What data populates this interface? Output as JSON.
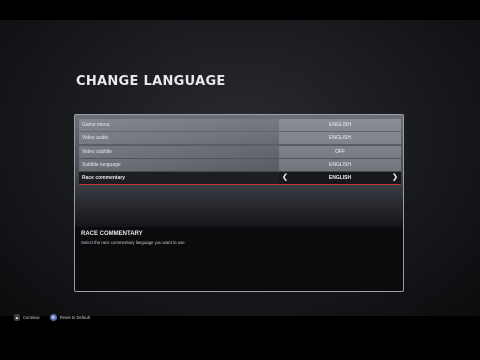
{
  "page": {
    "title": "CHANGE LANGUAGE"
  },
  "settings": [
    {
      "label": "Game menu",
      "value": "ENGLISH"
    },
    {
      "label": "Video audio",
      "value": "ENGLISH"
    },
    {
      "label": "Video subtitle",
      "value": "OFF"
    },
    {
      "label": "Subtitle language",
      "value": "ENGLISH"
    },
    {
      "label": "Race commentary",
      "value": "ENGLISH",
      "selected": true
    }
  ],
  "description": {
    "title": "RACE COMMENTARY",
    "text": "Select the race commentary language you want to use"
  },
  "footer": {
    "continue_icon": "trigger-button-icon",
    "continue_label": "Continue",
    "reset_icon": "x-button-icon",
    "reset_label": "Reset to Default"
  },
  "colors": {
    "selection_accent": "#c8343c",
    "panel_border": "#9a9ca3"
  }
}
